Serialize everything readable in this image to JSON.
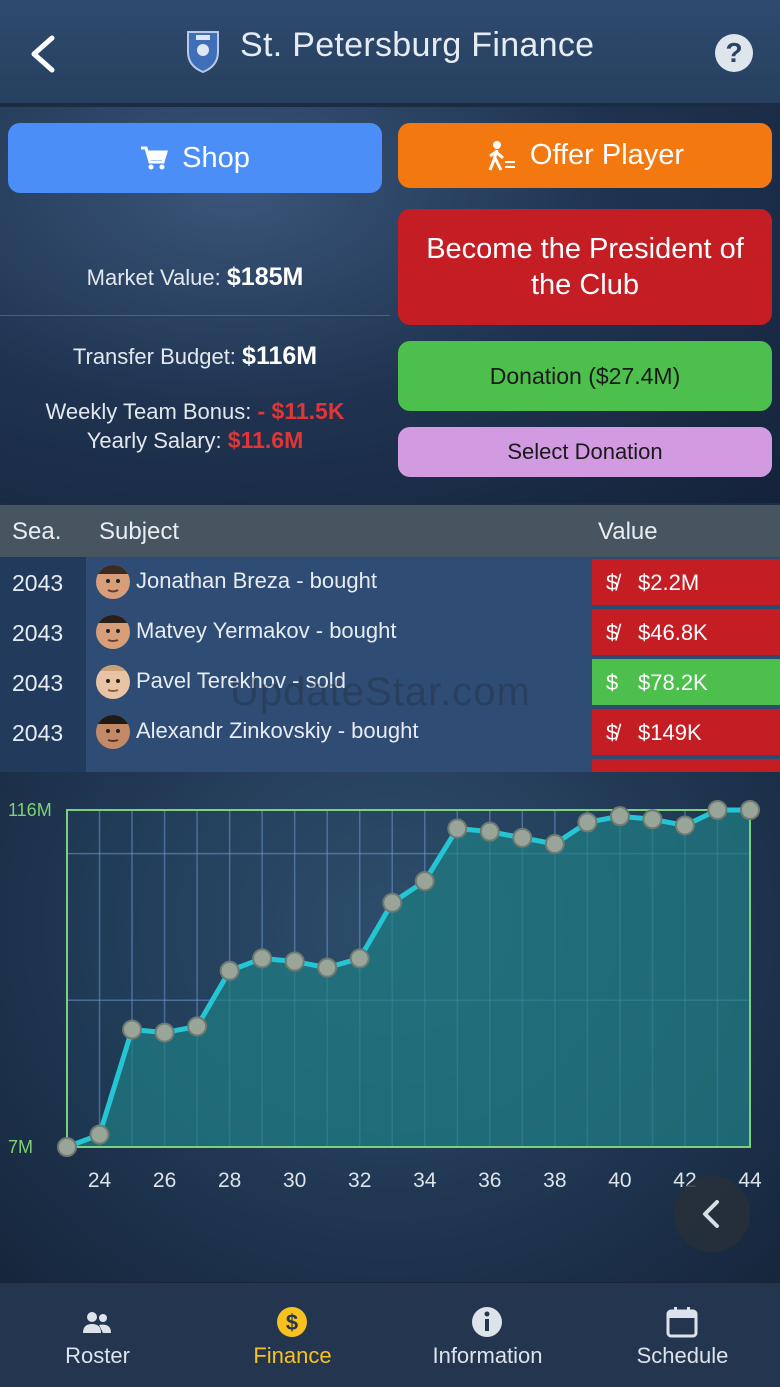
{
  "header": {
    "title": "St. Petersburg Finance",
    "help_label": "?"
  },
  "buttons": {
    "shop": "Shop",
    "offer_player": "Offer Player",
    "president": "Become the President of the Club",
    "donation": "Donation ($27.4M)",
    "select_donation": "Select Donation"
  },
  "stats": {
    "market_value_label": "Market Value:",
    "market_value": "$185M",
    "transfer_budget_label": "Transfer Budget:",
    "transfer_budget": "$116M",
    "weekly_bonus_label": "Weekly Team Bonus:",
    "weekly_bonus": "- $11.5K",
    "yearly_salary_label": "Yearly Salary:",
    "yearly_salary": "$11.6M"
  },
  "table": {
    "headers": [
      "Sea.",
      "Subject",
      "Value"
    ],
    "rows": [
      {
        "season": "2043",
        "subject": "Jonathan Breza  - bought",
        "value": "$2.2M",
        "type": "out"
      },
      {
        "season": "2043",
        "subject": "Matvey Yermakov  - bought",
        "value": "$46.8K",
        "type": "out"
      },
      {
        "season": "2043",
        "subject": "Pavel Terekhov  - sold",
        "value": "$78.2K",
        "type": "in"
      },
      {
        "season": "2043",
        "subject": "Alexandr Zinkovskiy  - bought",
        "value": "$149K",
        "type": "out"
      }
    ]
  },
  "watermark": "UpdateStar.com",
  "chart_data": {
    "type": "area",
    "x": [
      23,
      24,
      25,
      26,
      27,
      28,
      29,
      30,
      31,
      32,
      33,
      34,
      35,
      36,
      37,
      38,
      39,
      40,
      41,
      42,
      43,
      44
    ],
    "values": [
      7,
      11,
      45,
      44,
      46,
      64,
      68,
      67,
      65,
      68,
      86,
      93,
      110,
      109,
      107,
      105,
      112,
      114,
      113,
      111,
      116,
      116
    ],
    "xticks": [
      "24",
      "26",
      "28",
      "30",
      "32",
      "34",
      "36",
      "38",
      "40",
      "42",
      "44"
    ],
    "ytick_labels": [
      "116M",
      "7M"
    ],
    "ylim": [
      7,
      116
    ],
    "xlim": [
      23,
      44
    ],
    "grid": true,
    "colors": {
      "line": "#25c6d4",
      "fill": "#1f7f84",
      "marker": "#9aa59a",
      "frame": "#7fd07a"
    }
  },
  "nav": {
    "items": [
      {
        "label": "Roster",
        "icon": "users-icon"
      },
      {
        "label": "Finance",
        "icon": "dollar-icon"
      },
      {
        "label": "Information",
        "icon": "info-icon"
      },
      {
        "label": "Schedule",
        "icon": "calendar-icon"
      }
    ],
    "active": "Finance"
  }
}
